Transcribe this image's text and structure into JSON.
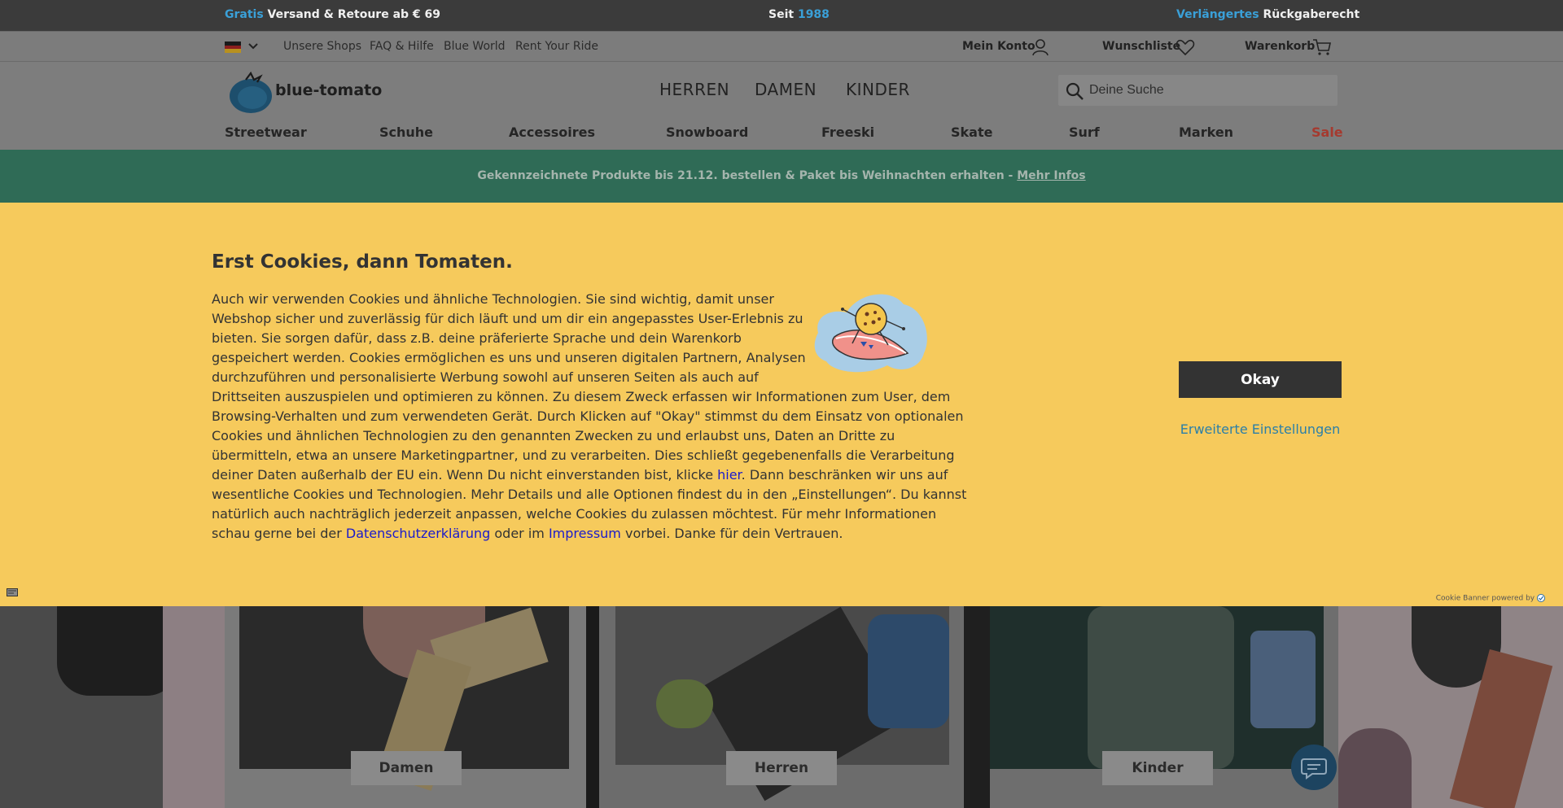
{
  "topbar": {
    "left_accent": "Gratis",
    "left_text": " Versand & Retoure ab € 69",
    "center_text": "Seit ",
    "center_accent": "1988",
    "right_accent": "Verlängertes",
    "right_text": " Rückgaberecht"
  },
  "utility": {
    "links": [
      "Unsere Shops",
      "FAQ & Hilfe",
      "Blue World",
      "Rent Your Ride"
    ],
    "account": "Mein Konto",
    "wishlist": "Wunschliste",
    "cart": "Warenkorb"
  },
  "header": {
    "logo_text": "blue-tomato",
    "main_nav": [
      "HERREN",
      "DAMEN",
      "KINDER"
    ],
    "search_placeholder": "Deine Suche",
    "categories": [
      "Streetwear",
      "Schuhe",
      "Accessoires",
      "Snowboard",
      "Freeski",
      "Skate",
      "Surf",
      "Marken",
      "Sale"
    ]
  },
  "promo": {
    "text": "Gekennzeichnete Produkte bis 21.12. bestellen & Paket bis Weihnachten erhalten - ",
    "link": "Mehr Infos"
  },
  "cookie": {
    "title": "Erst Cookies, dann Tomaten.",
    "p1": "Auch wir verwenden Cookies und ähnliche Technologien. Sie sind wichtig, damit unser Webshop sicher und zuverlässig für dich läuft und um dir ein angepasstes User-Erlebnis zu bieten. Sie sorgen dafür, dass z.B. deine präferierte Sprache und dein Warenkorb gespeichert werden. Cookies ermöglichen es uns und unseren digitalen Partnern, Analysen durchzuführen und personalisierte Werbung sowohl auf unseren Seiten als auch auf Drittseiten auszuspielen und optimieren zu können. Zu diesem Zweck erfassen wir Informationen zum User, dem Browsing-Verhalten und zum verwendeten Gerät. Durch Klicken auf \"Okay\" stimmst du dem Einsatz von optionalen Cookies und ähnlichen Technologien zu den genannten Zwecken zu und erlaubst uns, Daten an Dritte zu übermitteln, etwa an unsere Marketingpartner, und zu verarbeiten. Dies schließt gegebenenfalls die Verarbeitung deiner Daten außerhalb der EU ein. Wenn Du nicht einverstanden bist, klicke ",
    "link_here": "hier",
    "p2": ". Dann beschränken wir uns auf wesentliche Cookies und Technologien. Mehr Details und alle Optionen findest du in den „Einstellungen“. Du kannst natürlich auch nachträglich jederzeit anpassen, welche Cookies du zulassen möchtest. Für mehr Informationen schau gerne bei der ",
    "link_privacy": "Datenschutzerklärung",
    "p3": " oder im ",
    "link_imprint": "Impressum",
    "p4": " vorbei. Danke für dein Vertrauen.",
    "okay": "Okay",
    "advanced": "Erweiterte Einstellungen",
    "powered": "Cookie Banner powered by"
  },
  "tiles": [
    "Damen",
    "Herren",
    "Kinder"
  ],
  "colors": {
    "accent_blue": "#3aa0d8",
    "promo_green": "#2f6b56",
    "cookie_yellow": "#f6ca5c",
    "sale_red": "#c0392b"
  }
}
